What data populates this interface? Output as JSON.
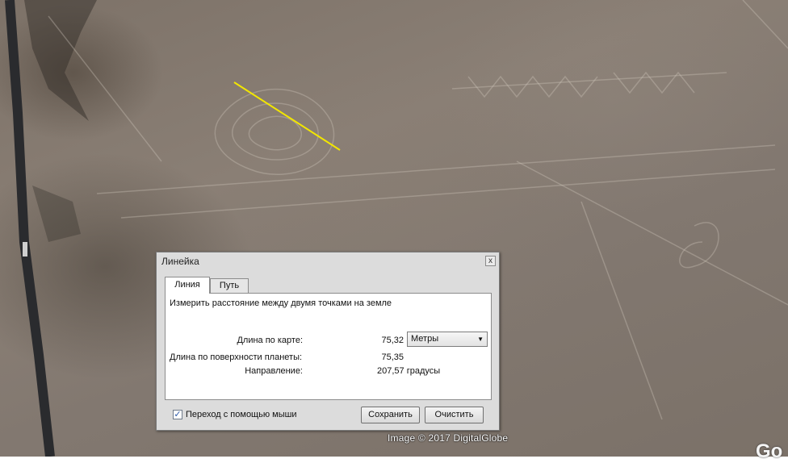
{
  "map": {
    "copyright": "Image © 2017 DigitalGlobe",
    "logo": "Go",
    "measure_line_color": "#f2e600"
  },
  "dialog": {
    "title": "Линейка",
    "close_glyph": "x",
    "tabs": [
      {
        "label": "Линия",
        "active": true
      },
      {
        "label": "Путь",
        "active": false
      }
    ],
    "description": "Измерить расстояние между двумя точками на земле",
    "map_length_label": "Длина по карте:",
    "map_length_value": "75,32",
    "units_selected": "Метры",
    "surface_length_label": "Длина по поверхности планеты:",
    "surface_length_value": "75,35",
    "heading_label": "Направление:",
    "heading_value": "207,57 градусы",
    "mouse_nav_label": "Переход с помощью мыши",
    "mouse_nav_checked": true,
    "save_label": "Сохранить",
    "clear_label": "Очистить"
  }
}
